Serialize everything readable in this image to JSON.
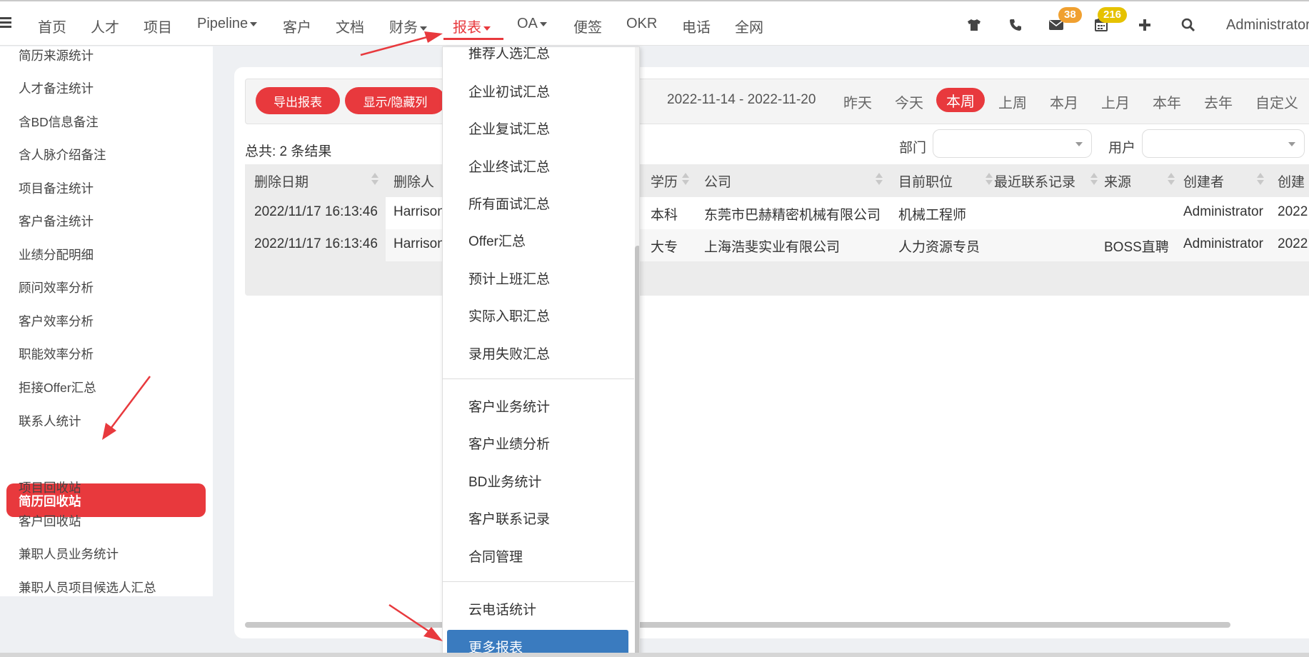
{
  "nav": {
    "items": [
      {
        "label": "首页",
        "caret": false
      },
      {
        "label": "人才",
        "caret": false
      },
      {
        "label": "项目",
        "caret": false
      },
      {
        "label": "Pipeline",
        "caret": true
      },
      {
        "label": "客户",
        "caret": false
      },
      {
        "label": "文档",
        "caret": false
      },
      {
        "label": "财务",
        "caret": true
      },
      {
        "label": "报表",
        "caret": true,
        "active": true
      },
      {
        "label": "OA",
        "caret": true
      },
      {
        "label": "便签",
        "caret": false
      },
      {
        "label": "OKR",
        "caret": false
      },
      {
        "label": "电话",
        "caret": false
      },
      {
        "label": "全网",
        "caret": false
      }
    ],
    "mail_badge": "38",
    "calendar_badge": "216",
    "user": "Administrator",
    "icons": [
      "shirt-icon",
      "phone-icon",
      "mail-icon",
      "calendar-icon",
      "plus-icon",
      "search-icon"
    ]
  },
  "sidebar": {
    "items": [
      "简历来源统计",
      "人才备注统计",
      "含BD信息备注",
      "含人脉介绍备注",
      "项目备注统计",
      "客户备注统计",
      "业绩分配明细",
      "顾问效率分析",
      "客户效率分析",
      "职能效率分析",
      "拒接Offer汇总",
      "联系人统计",
      "简历回收站",
      "项目回收站",
      "客户回收站",
      "兼职人员业务统计",
      "兼职人员项目候选人汇总"
    ],
    "active": "简历回收站"
  },
  "toolbar": {
    "export_label": "导出报表",
    "toggle_columns_label": "显示/隐藏列",
    "date_range": "2022-11-14 - 2022-11-20",
    "periods": [
      "昨天",
      "今天",
      "本周",
      "上周",
      "本月",
      "上月",
      "本年",
      "去年",
      "自定义"
    ],
    "active_period": "本周"
  },
  "filters": {
    "department_label": "部门",
    "user_label": "用户"
  },
  "summary": {
    "total": "总共: 2 条结果"
  },
  "table": {
    "headers": [
      "删除日期",
      "删除人",
      "学历",
      "公司",
      "目前职位",
      "最近联系记录",
      "来源",
      "创建者",
      "创建"
    ],
    "rows": [
      {
        "date": "2022/11/17 16:13:46",
        "deleter": "Harrison",
        "edu": "本科",
        "company": "东莞市巴赫精密机械有限公司",
        "position": "机械工程师",
        "last_contact": "",
        "source": "",
        "creator": "Administrator",
        "created": "2022"
      },
      {
        "date": "2022/11/17 16:13:46",
        "deleter": "Harrison",
        "edu": "大专",
        "company": "上海浩斐实业有限公司",
        "position": "人力资源专员",
        "last_contact": "",
        "source": "BOSS直聘",
        "creator": "Administrator",
        "created": "2022"
      }
    ]
  },
  "dropdown": {
    "group1": [
      "推荐人选汇总",
      "企业初试汇总",
      "企业复试汇总",
      "企业终试汇总",
      "所有面试汇总",
      "Offer汇总",
      "预计上班汇总",
      "实际入职汇总",
      "录用失败汇总"
    ],
    "group2": [
      "客户业务统计",
      "客户业绩分析",
      "BD业务统计",
      "客户联系记录",
      "合同管理"
    ],
    "group3": [
      "云电话统计"
    ],
    "more_label": "更多报表"
  },
  "colors": {
    "accent": "#e8393d",
    "badge_orange": "#f0a030",
    "badge_yellow": "#e6c200",
    "more_blue": "#3a7bbf"
  }
}
